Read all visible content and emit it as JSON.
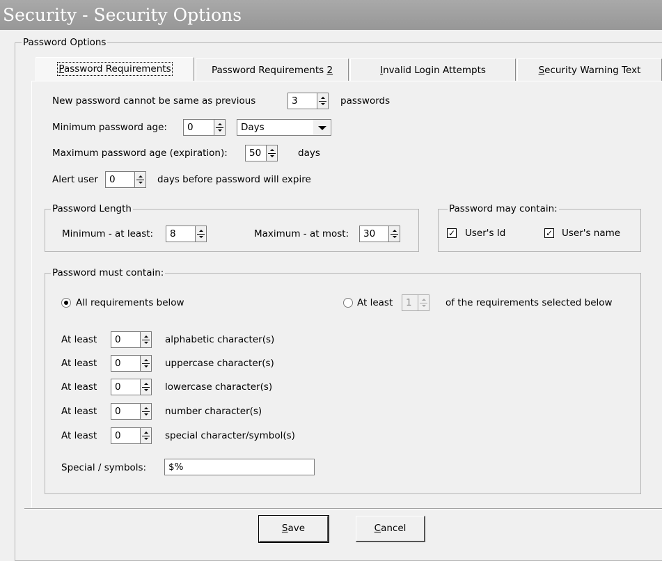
{
  "window": {
    "title": "Security - Security Options"
  },
  "password_options": {
    "legend": "Password Options"
  },
  "tabs": [
    {
      "pre": "",
      "key": "P",
      "post": "assword Requirements"
    },
    {
      "pre": "Password Requirements ",
      "key": "2",
      "post": ""
    },
    {
      "pre": "",
      "key": "I",
      "post": "nvalid Login Attempts"
    },
    {
      "pre": "",
      "key": "S",
      "post": "ecurity Warning Text"
    }
  ],
  "general": {
    "history_prefix": "New password cannot be same as previous",
    "history_value": "3",
    "history_suffix": "passwords",
    "min_age_label": "Minimum password age:",
    "min_age_value": "0",
    "min_age_unit": "Days",
    "max_age_label": "Maximum password age (expiration):",
    "max_age_value": "50",
    "max_age_suffix": "days",
    "alert_prefix": "Alert user",
    "alert_value": "0",
    "alert_suffix": "days before password will expire"
  },
  "length": {
    "legend": "Password Length",
    "min_label": "Minimum - at least:",
    "min_value": "8",
    "max_label": "Maximum - at most:",
    "max_value": "30"
  },
  "may_contain": {
    "legend": "Password may contain:",
    "user_id_label": "User's Id",
    "user_id_checked": true,
    "user_name_label": "User's name",
    "user_name_checked": true
  },
  "must_contain": {
    "legend": "Password must contain:",
    "all_label": "All requirements below",
    "all_selected": true,
    "atleast_prefix": "At least",
    "atleast_value": "1",
    "atleast_suffix": "of the requirements selected below",
    "rows": [
      {
        "prefix": "At least",
        "value": "0",
        "label": "alphabetic character(s)"
      },
      {
        "prefix": "At least",
        "value": "0",
        "label": "uppercase character(s)"
      },
      {
        "prefix": "At least",
        "value": "0",
        "label": "lowercase character(s)"
      },
      {
        "prefix": "At least",
        "value": "0",
        "label": "number character(s)"
      },
      {
        "prefix": "At least",
        "value": "0",
        "label": "special character/symbol(s)"
      }
    ],
    "special_label": "Special / symbols:",
    "special_value": "$%"
  },
  "buttons": {
    "save_key": "S",
    "save_rest": "ave",
    "cancel_key": "C",
    "cancel_rest": "ancel"
  }
}
